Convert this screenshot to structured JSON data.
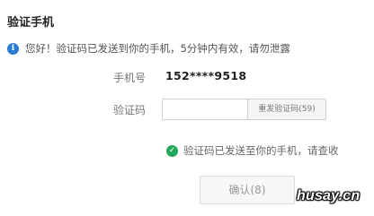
{
  "page": {
    "title": "验证手机"
  },
  "notice": {
    "text": "您好！验证码已发送到你的手机，5分钟内有效，请勿泄露"
  },
  "form": {
    "phone_label": "手机号",
    "phone_value": "152****9518",
    "code_label": "验证码",
    "code_value": "",
    "code_placeholder": "",
    "resend_label": "重发验证码(59)"
  },
  "status": {
    "text": "验证码已发送至你的手机，请查收"
  },
  "confirm": {
    "label": "确认(8)"
  },
  "watermark": {
    "text": "husay.cn"
  },
  "colors": {
    "info": "#2b7cd3",
    "success": "#21a85a"
  },
  "icons": {
    "notice": "info-icon",
    "status": "check-icon"
  }
}
